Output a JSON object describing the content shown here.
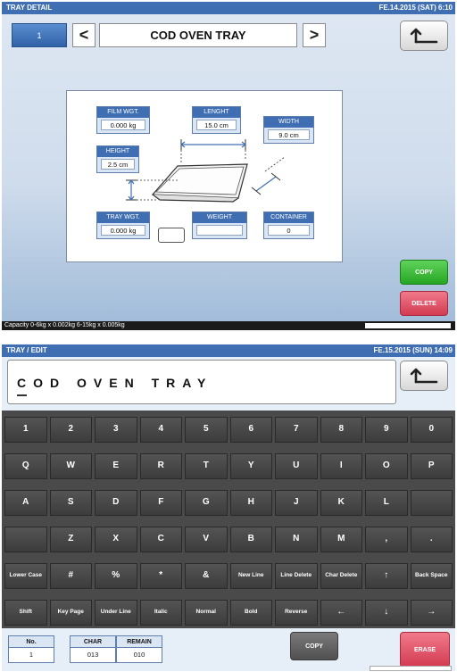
{
  "screen1": {
    "title": "TRAY DETAIL",
    "datetime": "FE.14.2015 (SAT)  6:10",
    "tray_number": "1",
    "prev_arrow": "<",
    "next_arrow": ">",
    "tray_name": "COD OVEN TRAY",
    "fields": {
      "film_wgt": {
        "label": "FILM WGT.",
        "value": "0.000 kg"
      },
      "lenght": {
        "label": "LENGHT",
        "value": "15.0 cm"
      },
      "width": {
        "label": "WIDTH",
        "value": "9.0 cm"
      },
      "height": {
        "label": "HEIGHT",
        "value": "2.5 cm"
      },
      "tray_wgt": {
        "label": "TRAY WGT.",
        "value": "0.000 kg"
      },
      "weight": {
        "label": "WEIGHT",
        "value": ""
      },
      "container": {
        "label": "CONTAINER",
        "value": "0"
      }
    },
    "copy_label": "COPY",
    "delete_label": "DELETE",
    "status": "Capacity 0-6kg x 0.002kg  6-15kg x 0.005kg"
  },
  "screen2": {
    "title": "TRAY / EDIT",
    "datetime": "FE.15.2015 (SUN)  14:09",
    "text_value": "COD OVEN TRAY",
    "keyboard_rows": [
      [
        "1",
        "2",
        "3",
        "4",
        "5",
        "6",
        "7",
        "8",
        "9",
        "0"
      ],
      [
        "Q",
        "W",
        "E",
        "R",
        "T",
        "Y",
        "U",
        "I",
        "O",
        "P"
      ],
      [
        "A",
        "S",
        "D",
        "F",
        "G",
        "H",
        "J",
        "K",
        "L",
        ""
      ],
      [
        "",
        "Z",
        "X",
        "C",
        "V",
        "B",
        "N",
        "M",
        ",",
        "."
      ],
      [
        "Lower Case",
        "#",
        "%",
        "*",
        "&",
        "New Line",
        "Line Delete",
        "Char Delete",
        "↑",
        "Back Space"
      ],
      [
        "Shift",
        "Key Page",
        "Under Line",
        "Italic",
        "Normal",
        "Bold",
        "Reverse",
        "←",
        "↓",
        "→"
      ]
    ],
    "counters": {
      "no": {
        "label": "No.",
        "value": "1"
      },
      "char": {
        "label": "CHAR",
        "value": "013"
      },
      "remain": {
        "label": "REMAIN",
        "value": "010"
      }
    },
    "copy_label": "COPY",
    "erase_label": "ERASE"
  },
  "colors": {
    "title_bar": "#3f6fb2",
    "copy_green": "#27a623",
    "delete_red": "#d33b52",
    "keyboard_key": "#4a4a4a"
  },
  "icons": [
    "return-arrow-icon",
    "dimension-arrow-icon",
    "tray-drawing-icon"
  ]
}
